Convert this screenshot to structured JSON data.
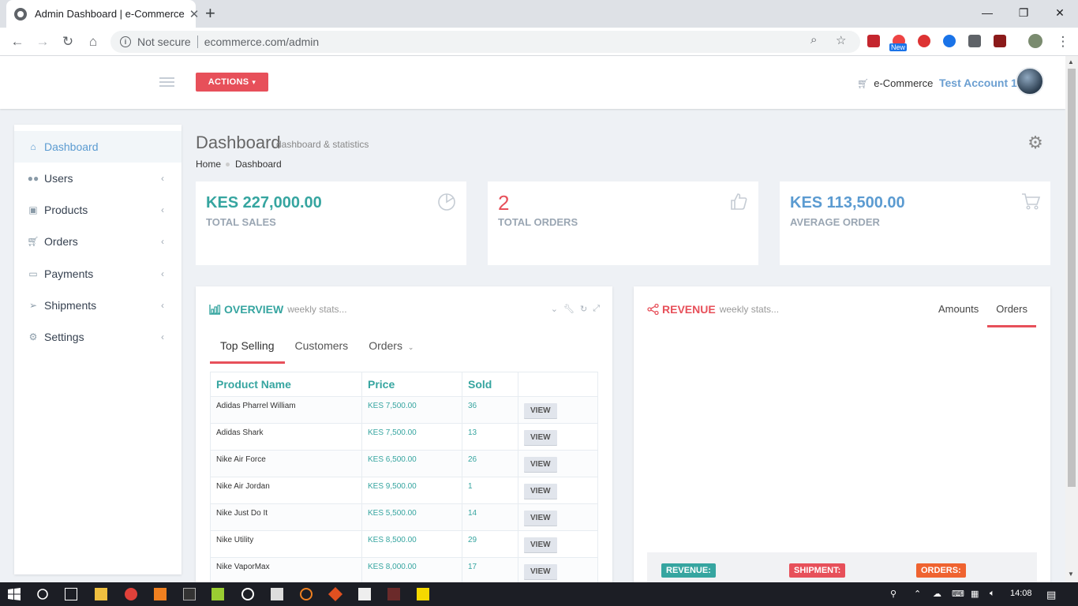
{
  "browser": {
    "tab_title": "Admin Dashboard | e-Commerce",
    "security_label": "Not secure",
    "url": "ecommerce.com/admin",
    "extension_badge": "New"
  },
  "header": {
    "actions_label": "ACTIONS",
    "shop_label": "e-Commerce",
    "account_name": "Test Account 1"
  },
  "sidebar": {
    "items": [
      {
        "label": "Dashboard",
        "icon": "home-icon"
      },
      {
        "label": "Users",
        "icon": "users-icon"
      },
      {
        "label": "Products",
        "icon": "gift-icon"
      },
      {
        "label": "Orders",
        "icon": "cart-icon"
      },
      {
        "label": "Payments",
        "icon": "money-icon"
      },
      {
        "label": "Shipments",
        "icon": "paper-plane-icon"
      },
      {
        "label": "Settings",
        "icon": "gears-icon"
      }
    ]
  },
  "page": {
    "title": "Dashboard",
    "subtitle": "dashboard & statistics",
    "breadcrumb": [
      "Home",
      "Dashboard"
    ]
  },
  "stats": [
    {
      "value": "KES 227,000.00",
      "label": "TOTAL SALES",
      "color": "#36a5a0",
      "icon": "pie-chart-icon"
    },
    {
      "value": "2",
      "label": "TOTAL ORDERS",
      "color": "#e7505a",
      "icon": "thumbs-up-icon"
    },
    {
      "value": "KES 113,500.00",
      "label": "AVERAGE ORDER",
      "color": "#5b9bd1",
      "icon": "cart-icon"
    }
  ],
  "overview": {
    "title": "OVERVIEW",
    "subtitle": "weekly stats...",
    "tabs": [
      "Top Selling",
      "Customers",
      "Orders"
    ],
    "columns": [
      "Product Name",
      "Price",
      "Sold",
      ""
    ],
    "view_label": "VIEW",
    "rows": [
      {
        "name": "Adidas Pharrel William",
        "price": "KES 7,500.00",
        "sold": "36"
      },
      {
        "name": "Adidas Shark",
        "price": "KES 7,500.00",
        "sold": "13"
      },
      {
        "name": "Nike Air Force",
        "price": "KES 6,500.00",
        "sold": "26"
      },
      {
        "name": "Nike Air Jordan",
        "price": "KES 9,500.00",
        "sold": "1"
      },
      {
        "name": "Nike Just Do It",
        "price": "KES 5,500.00",
        "sold": "14"
      },
      {
        "name": "Nike Utility",
        "price": "KES 8,500.00",
        "sold": "29"
      },
      {
        "name": "Nike VaporMax",
        "price": "KES 8,000.00",
        "sold": "17"
      }
    ]
  },
  "revenue": {
    "title": "REVENUE",
    "subtitle": "weekly stats...",
    "tabs": [
      "Amounts",
      "Orders"
    ],
    "badges": [
      {
        "label": "REVENUE:",
        "color": "#36a5a0"
      },
      {
        "label": "SHIPMENT:",
        "color": "#e7505a"
      },
      {
        "label": "ORDERS:",
        "color": "#ef6330"
      }
    ]
  },
  "taskbar": {
    "time": "14:08"
  },
  "colors": {
    "accent_red": "#e7505a",
    "accent_teal": "#36a5a0",
    "accent_blue": "#5b9bd1"
  }
}
